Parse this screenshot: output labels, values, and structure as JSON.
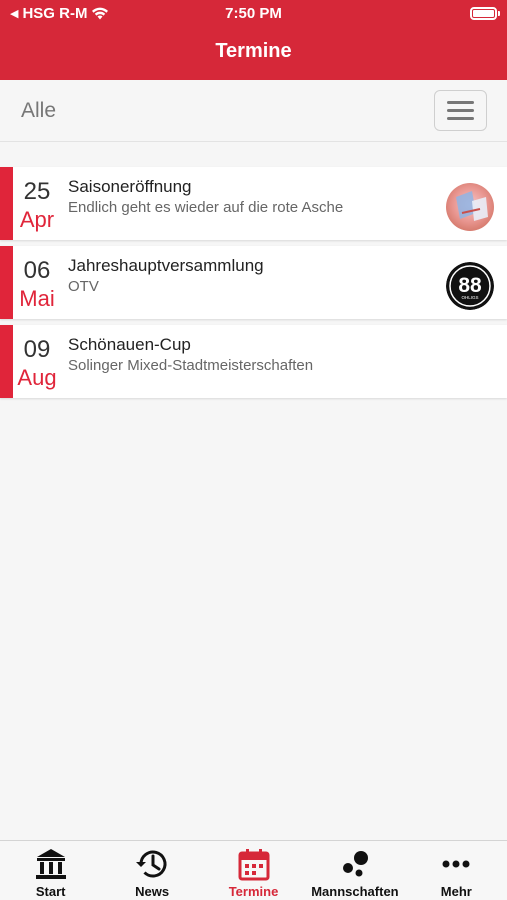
{
  "status_bar": {
    "carrier": "HSG R-M",
    "time": "7:50 PM"
  },
  "header": {
    "title": "Termine"
  },
  "filter": {
    "label": "Alle"
  },
  "events": [
    {
      "day": "25",
      "month": "Apr",
      "title": "Saisoneröffnung",
      "subtitle": "Endlich geht es wieder auf die rote Asche",
      "logo": "club-photo"
    },
    {
      "day": "06",
      "month": "Mai",
      "title": "Jahreshauptversammlung",
      "subtitle": "OTV",
      "logo": "88-logo",
      "logo_text": "88",
      "logo_subtext": "OHLIGS"
    },
    {
      "day": "09",
      "month": "Aug",
      "title": "Schönauen-Cup",
      "subtitle": "Solinger Mixed-Stadtmeisterschaften",
      "logo": ""
    }
  ],
  "tabs": [
    {
      "label": "Start",
      "icon": "bank-icon"
    },
    {
      "label": "News",
      "icon": "history-icon"
    },
    {
      "label": "Termine",
      "icon": "calendar-icon",
      "active": true
    },
    {
      "label": "Mannschaften",
      "icon": "group-dots-icon"
    },
    {
      "label": "Mehr",
      "icon": "more-dots-icon"
    }
  ],
  "colors": {
    "brand": "#d62839",
    "accent": "#e0253a"
  }
}
